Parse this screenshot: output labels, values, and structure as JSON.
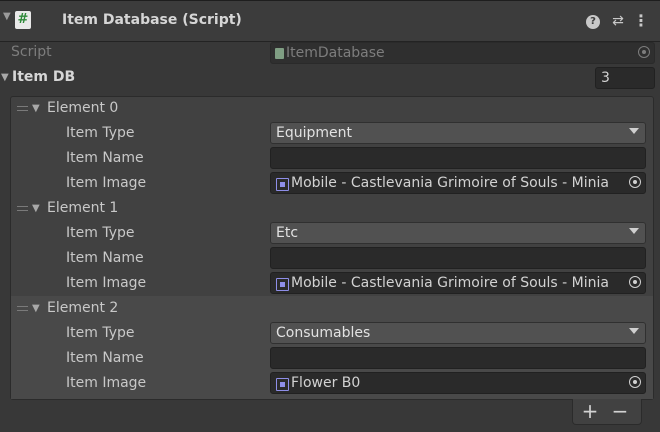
{
  "header": {
    "title": "Item Database (Script)",
    "script_icon_glyph": "#",
    "icons": [
      "help-icon",
      "settings-icon",
      "menu-icon"
    ]
  },
  "script_row": {
    "label": "Script",
    "value": "ItemDatabase"
  },
  "list": {
    "label": "Item DB",
    "size": "3",
    "elements": [
      {
        "title": "Element 0",
        "type_label": "Item Type",
        "type_value": "Equipment",
        "name_label": "Item Name",
        "name_value": "",
        "image_label": "Item Image",
        "image_value": "Mobile - Castlevania Grimoire of Souls - Minia"
      },
      {
        "title": "Element 1",
        "type_label": "Item Type",
        "type_value": "Etc",
        "name_label": "Item Name",
        "name_value": "",
        "image_label": "Item Image",
        "image_value": "Mobile - Castlevania Grimoire of Souls - Minia"
      },
      {
        "title": "Element 2",
        "type_label": "Item Type",
        "type_value": "Consumables",
        "name_label": "Item Name",
        "name_value": "",
        "image_label": "Item Image",
        "image_value": "Flower B0"
      }
    ],
    "add_label": "+",
    "remove_label": "−"
  }
}
